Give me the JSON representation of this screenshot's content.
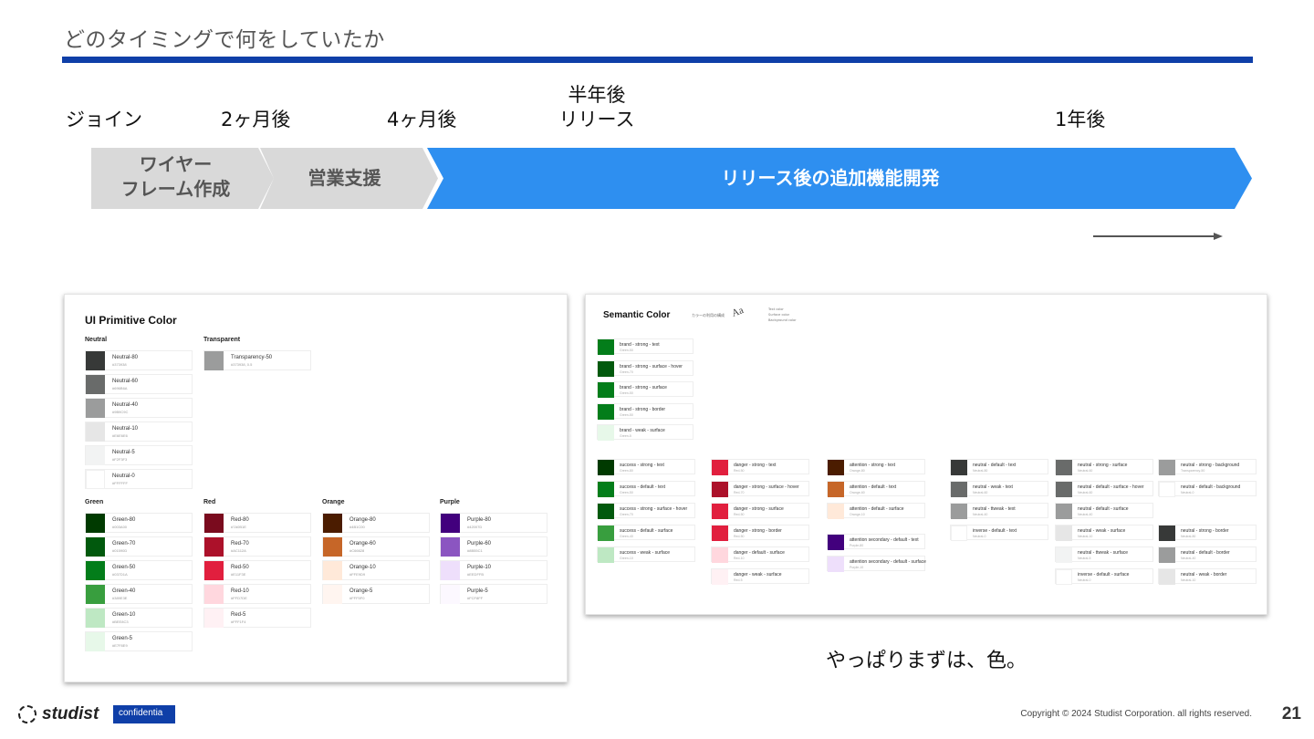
{
  "slide": {
    "title": "どのタイミングで何をしていたか",
    "page_number": "21",
    "note": "やっぱりまずは、色。",
    "confidential": "confidentia",
    "copyright": "Copyright © 2024 Studist Corporation. all rights reserved.",
    "brand": "studist",
    "accent_color": "#0f3fa8"
  },
  "timeline": {
    "labels": {
      "join": "ジョイン",
      "m2": "2ヶ月後",
      "m4": "4ヶ月後",
      "half_line1": "半年後",
      "half_line2": "リリース",
      "y1": "1年後"
    },
    "phases": {
      "wireframe_line1": "ワイヤー",
      "wireframe_line2": "フレーム作成",
      "sales": "営業支援",
      "post_release": "リリース後の追加機能開発"
    },
    "colors": {
      "grey": "#d9d9d9",
      "blue": "#2e8ff0"
    }
  },
  "primitive_card": {
    "title": "UI Primitive Color",
    "groups": {
      "neutral": {
        "title": "Neutral",
        "items": [
          {
            "name": "Neutral-80",
            "hex": "#373938",
            "color": "#373938"
          },
          {
            "name": "Neutral-60",
            "hex": "#696B6A",
            "color": "#696b6a"
          },
          {
            "name": "Neutral-40",
            "hex": "#9B9C9C",
            "color": "#9b9c9c"
          },
          {
            "name": "Neutral-10",
            "hex": "#E6E6E6",
            "color": "#e6e6e6"
          },
          {
            "name": "Neutral-5",
            "hex": "#F2F3F3",
            "color": "#f2f3f3"
          },
          {
            "name": "Neutral-0",
            "hex": "#FFFFFF",
            "color": "#ffffff"
          }
        ]
      },
      "transparent": {
        "title": "Transparent",
        "items": [
          {
            "name": "Transparency-50",
            "hex": "#373938, 0.5",
            "color": "#9b9c9c"
          }
        ]
      },
      "green": {
        "title": "Green",
        "items": [
          {
            "name": "Green-80",
            "hex": "#003A00",
            "color": "#003a00"
          },
          {
            "name": "Green-70",
            "hex": "#01590D",
            "color": "#01590d"
          },
          {
            "name": "Green-50",
            "hex": "#037D1A",
            "color": "#037d1a"
          },
          {
            "name": "Green-40",
            "hex": "#389E3E",
            "color": "#389e3e"
          },
          {
            "name": "Green-10",
            "hex": "#BEE8C3",
            "color": "#bee8c3"
          },
          {
            "name": "Green-5",
            "hex": "#E7F8E9",
            "color": "#e7f8e9"
          }
        ]
      },
      "red": {
        "title": "Red",
        "items": [
          {
            "name": "Red-80",
            "hex": "#7A0B1E",
            "color": "#7a0b1e"
          },
          {
            "name": "Red-70",
            "hex": "#AC112A",
            "color": "#ac112a"
          },
          {
            "name": "Red-50",
            "hex": "#E11F3E",
            "color": "#e11f3e"
          },
          {
            "name": "Red-10",
            "hex": "#FFD7DE",
            "color": "#ffd7de"
          },
          {
            "name": "Red-5",
            "hex": "#FFF1F4",
            "color": "#fff1f4"
          }
        ]
      },
      "orange": {
        "title": "Orange",
        "items": [
          {
            "name": "Orange-80",
            "hex": "#4B1C00",
            "color": "#4b1c00"
          },
          {
            "name": "Orange-60",
            "hex": "#C66628",
            "color": "#c66628"
          },
          {
            "name": "Orange-10",
            "hex": "#FFE9D9",
            "color": "#ffe9d9"
          },
          {
            "name": "Orange-5",
            "hex": "#FFF5F0",
            "color": "#fff5f0"
          }
        ]
      },
      "purple": {
        "title": "Purple",
        "items": [
          {
            "name": "Purple-80",
            "hex": "#42007D",
            "color": "#42007d"
          },
          {
            "name": "Purple-60",
            "hex": "#8B55C1",
            "color": "#8b55c1"
          },
          {
            "name": "Purple-10",
            "hex": "#EEDFFB",
            "color": "#eedffb"
          },
          {
            "name": "Purple-5",
            "hex": "#FCF8FF",
            "color": "#fcf8ff"
          }
        ]
      }
    }
  },
  "semantic_card": {
    "title": "Semantic Color",
    "caption": "カラーの利用の構成",
    "legend_mark": "Aa",
    "legend_lines": [
      "Text color",
      "Surface color",
      "Background color"
    ],
    "brand": [
      {
        "name": "brand - strong - text",
        "sub": "Green-50",
        "color": "#037d1a"
      },
      {
        "name": "brand - strong - surface - hover",
        "sub": "Green-70",
        "color": "#01590d"
      },
      {
        "name": "brand - strong - surface",
        "sub": "Green-50",
        "color": "#037d1a"
      },
      {
        "name": "brand - strong - border",
        "sub": "Green-50",
        "color": "#037d1a"
      },
      {
        "name": "brand - weak - surface",
        "sub": "Green-5",
        "color": "#e7f8e9"
      }
    ],
    "columns": [
      [
        {
          "name": "success - strong - text",
          "sub": "Green-80",
          "color": "#003a00"
        },
        {
          "name": "success - default - text",
          "sub": "Green-50",
          "color": "#037d1a"
        },
        {
          "name": "success - strong - surface - hover",
          "sub": "Green-70",
          "color": "#01590d"
        },
        {
          "name": "success - default - surface",
          "sub": "Green-40",
          "color": "#389e3e"
        },
        {
          "name": "success - weak - surface",
          "sub": "Green-10",
          "color": "#bee8c3"
        }
      ],
      [
        {
          "name": "danger - strong - text",
          "sub": "Red-50",
          "color": "#e11f3e"
        },
        {
          "name": "danger - strong - surface - hover",
          "sub": "Red-70",
          "color": "#ac112a"
        },
        {
          "name": "danger - strong - surface",
          "sub": "Red-50",
          "color": "#e11f3e"
        },
        {
          "name": "danger - strong - border",
          "sub": "Red-50",
          "color": "#e11f3e"
        },
        {
          "name": "danger - default - surface",
          "sub": "Red-10",
          "color": "#ffd7de"
        },
        {
          "name": "danger - weak - surface",
          "sub": "Red-5",
          "color": "#fff1f4"
        }
      ],
      [
        {
          "name": "attention - strong - text",
          "sub": "Orange-80",
          "color": "#4b1c00"
        },
        {
          "name": "attention - default - text",
          "sub": "Orange-60",
          "color": "#c66628"
        },
        {
          "name": "attention - default - surface",
          "sub": "Orange-10",
          "color": "#ffe9d9"
        },
        {
          "name": "attention secondary - default - text",
          "sub": "Purple-80",
          "color": "#42007d"
        },
        {
          "name": "attention secondary - default - surface",
          "sub": "Purple-10",
          "color": "#eedffb"
        }
      ],
      [
        {
          "name": "neutral - default - text",
          "sub": "Neutral-80",
          "color": "#373938"
        },
        {
          "name": "neutral - weak - text",
          "sub": "Neutral-60",
          "color": "#696b6a"
        },
        {
          "name": "neutral - ttweak - text",
          "sub": "Neutral-40",
          "color": "#9b9c9c"
        },
        {
          "name": "inverse - default - text",
          "sub": "Neutral-0",
          "color": "#ffffff"
        }
      ],
      [
        {
          "name": "neutral - strong - surface",
          "sub": "Neutral-60",
          "color": "#696b6a"
        },
        {
          "name": "neutral - default - surface - hover",
          "sub": "Neutral-60",
          "color": "#696b6a"
        },
        {
          "name": "neutral - default - surface",
          "sub": "Neutral-40",
          "color": "#9b9c9c"
        },
        {
          "name": "neutral - weak - surface",
          "sub": "Neutral-10",
          "color": "#e6e6e6"
        },
        {
          "name": "neutral - ttweak - surface",
          "sub": "Neutral-5",
          "color": "#f2f3f3"
        },
        {
          "name": "inverse - default - surface",
          "sub": "Neutral-0",
          "color": "#ffffff"
        }
      ],
      [
        {
          "name": "neutral - strong - background",
          "sub": "Transparency-50",
          "color": "#9b9c9c"
        },
        {
          "name": "neutral - default - background",
          "sub": "Neutral-0",
          "color": "#ffffff"
        },
        {
          "name": "neutral - strong - border",
          "sub": "Neutral-80",
          "color": "#373938"
        },
        {
          "name": "neutral - default - border",
          "sub": "Neutral-40",
          "color": "#9b9c9c"
        },
        {
          "name": "neutral - weak - border",
          "sub": "Neutral-10",
          "color": "#e6e6e6"
        }
      ]
    ]
  }
}
